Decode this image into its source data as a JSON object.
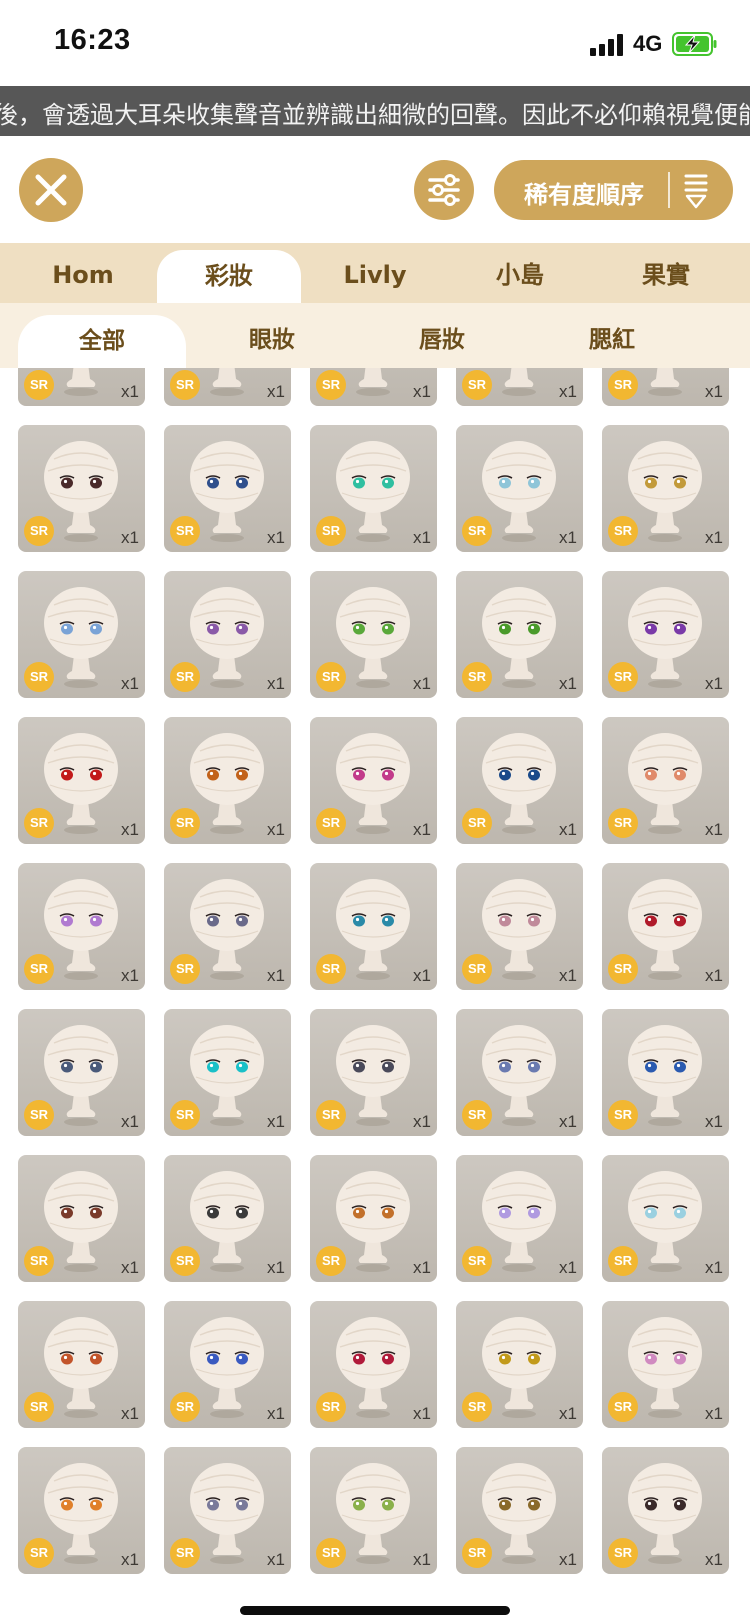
{
  "status_bar": {
    "time": "16:23",
    "network": "4G",
    "battery_color": "#44c42e"
  },
  "ticker": {
    "text": "後，會透過大耳朵收集聲音並辨識出細微的回聲。因此不必仰賴視覺便能"
  },
  "toolbar": {
    "sort_label": "稀有度順序",
    "accent": "#cea65b"
  },
  "main_tabs": [
    {
      "label": "Hom",
      "active": false
    },
    {
      "label": "彩妝",
      "active": true
    },
    {
      "label": "Livly",
      "active": false
    },
    {
      "label": "小島",
      "active": false
    },
    {
      "label": "果實",
      "active": false
    }
  ],
  "sub_tabs": [
    {
      "label": "全部",
      "active": true
    },
    {
      "label": "眼妝",
      "active": false
    },
    {
      "label": "唇妝",
      "active": false
    },
    {
      "label": "腮紅",
      "active": false
    }
  ],
  "items": [
    {
      "rarity": "SR",
      "qty": "x1",
      "eye": "#2a2a2a"
    },
    {
      "rarity": "SR",
      "qty": "x1",
      "eye": "none"
    },
    {
      "rarity": "SR",
      "qty": "x1",
      "eye": "#6a4a8c"
    },
    {
      "rarity": "SR",
      "qty": "x1",
      "eye": "#c2186b"
    },
    {
      "rarity": "SR",
      "qty": "x1",
      "eye": "#b03a7a"
    },
    {
      "rarity": "SR",
      "qty": "x1",
      "eye": "#4a2a2a"
    },
    {
      "rarity": "SR",
      "qty": "x1",
      "eye": "#2f4f8c"
    },
    {
      "rarity": "SR",
      "qty": "x1",
      "eye": "#2fbfa0"
    },
    {
      "rarity": "SR",
      "qty": "x1",
      "eye": "#8fc5d8"
    },
    {
      "rarity": "SR",
      "qty": "x1",
      "eye": "#c29a3a"
    },
    {
      "rarity": "SR",
      "qty": "x1",
      "eye": "#7aa3d6"
    },
    {
      "rarity": "SR",
      "qty": "x1",
      "eye": "#8a5aa8"
    },
    {
      "rarity": "SR",
      "qty": "x1",
      "eye": "#5aa83a"
    },
    {
      "rarity": "SR",
      "qty": "x1",
      "eye": "#4a9a2a"
    },
    {
      "rarity": "SR",
      "qty": "x1",
      "eye": "#7a3aa8"
    },
    {
      "rarity": "SR",
      "qty": "x1",
      "eye": "#c21a1a"
    },
    {
      "rarity": "SR",
      "qty": "x1",
      "eye": "#c2621a"
    },
    {
      "rarity": "SR",
      "qty": "x1",
      "eye": "#c23a8a"
    },
    {
      "rarity": "SR",
      "qty": "x1",
      "eye": "#1a4a8a"
    },
    {
      "rarity": "SR",
      "qty": "x1",
      "eye": "#e08a6a"
    },
    {
      "rarity": "SR",
      "qty": "x1",
      "eye": "#b07ad0"
    },
    {
      "rarity": "SR",
      "qty": "x1",
      "eye": "#6a6a8a"
    },
    {
      "rarity": "SR",
      "qty": "x1",
      "eye": "#2a8aa8"
    },
    {
      "rarity": "SR",
      "qty": "x1",
      "eye": "#c08a9a"
    },
    {
      "rarity": "SR",
      "qty": "x1",
      "eye": "#b01a2a"
    },
    {
      "rarity": "SR",
      "qty": "x1",
      "eye": "#4a5a7a"
    },
    {
      "rarity": "SR",
      "qty": "x1",
      "eye": "#1ac0c8"
    },
    {
      "rarity": "SR",
      "qty": "x1",
      "eye": "#4a4a5a"
    },
    {
      "rarity": "SR",
      "qty": "x1",
      "eye": "#6a7ab0"
    },
    {
      "rarity": "SR",
      "qty": "x1",
      "eye": "#2a5ab0"
    },
    {
      "rarity": "SR",
      "qty": "x1",
      "eye": "#7a3a2a"
    },
    {
      "rarity": "SR",
      "qty": "x1",
      "eye": "#3a3a3a"
    },
    {
      "rarity": "SR",
      "qty": "x1",
      "eye": "#c2702a"
    },
    {
      "rarity": "SR",
      "qty": "x1",
      "eye": "#b09ae0"
    },
    {
      "rarity": "SR",
      "qty": "x1",
      "eye": "#9ad0e0"
    },
    {
      "rarity": "SR",
      "qty": "x1",
      "eye": "#c2542a"
    },
    {
      "rarity": "SR",
      "qty": "x1",
      "eye": "#3a5ac0"
    },
    {
      "rarity": "SR",
      "qty": "x1",
      "eye": "#b01a3a"
    },
    {
      "rarity": "SR",
      "qty": "x1",
      "eye": "#c29a1a"
    },
    {
      "rarity": "SR",
      "qty": "x1",
      "eye": "#d08ac0"
    },
    {
      "rarity": "SR",
      "qty": "x1",
      "eye": "#e0802a"
    },
    {
      "rarity": "SR",
      "qty": "x1",
      "eye": "#7a7a9a"
    },
    {
      "rarity": "SR",
      "qty": "x1",
      "eye": "#8ab04a"
    },
    {
      "rarity": "SR",
      "qty": "x1",
      "eye": "#8a6a2a"
    },
    {
      "rarity": "SR",
      "qty": "x1",
      "eye": "#3a2a2a"
    }
  ]
}
